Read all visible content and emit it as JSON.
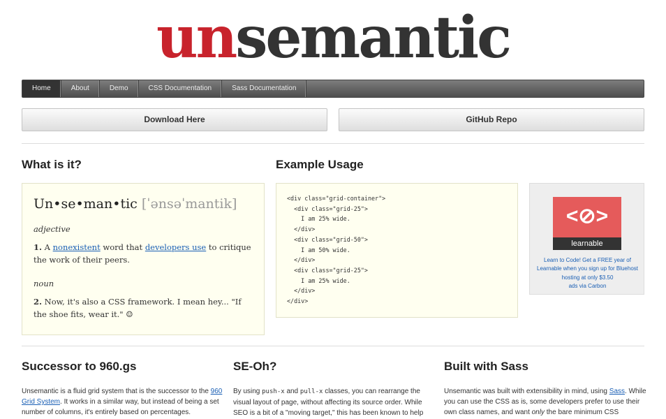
{
  "logo": {
    "part1": "un",
    "part2": "semantic"
  },
  "nav": {
    "items": [
      {
        "label": "Home",
        "active": true
      },
      {
        "label": "About"
      },
      {
        "label": "Demo"
      },
      {
        "label": "CSS Documentation"
      },
      {
        "label": "Sass Documentation"
      }
    ]
  },
  "buttons": {
    "download": "Download Here",
    "github": "GitHub Repo"
  },
  "what": {
    "heading": "What is it?",
    "word": "Un•se•man•tic",
    "pronunciation": "[ˈənsəˈmantik]",
    "pos1": "adjective",
    "def1_num": "1.",
    "def1_a": "A",
    "def1_link1": "nonexistent",
    "def1_b": "word that",
    "def1_link2": "developers use",
    "def1_c": "to critique the work of their peers.",
    "pos2": "noun",
    "def2_num": "2.",
    "def2_text": "Now, it's also a CSS framework. I mean hey... \"If the shoe fits, wear it.\" ☺"
  },
  "example": {
    "heading": "Example Usage",
    "code": "<div class=\"grid-container\">\n  <div class=\"grid-25\">\n    I am 25% wide.\n  </div>\n  <div class=\"grid-50\">\n    I am 50% wide.\n  </div>\n  <div class=\"grid-25\">\n    I am 25% wide.\n  </div>\n</div>"
  },
  "ad": {
    "brand": "learnable",
    "text": "Learn to Code! Get a FREE year of Learnable when you sign up for Bluehost hosting at only $3.50",
    "via": "ads via Carbon"
  },
  "columns": {
    "c1": {
      "heading": "Successor to 960.gs",
      "t1": "Unsemantic is a fluid grid system that is the successor to the",
      "link": "960 Grid System",
      "t2": ". It works in a similar way, but instead of being a set number of columns, it's entirely based on percentages."
    },
    "c2": {
      "heading": "SE-Oh?",
      "t1": "By using",
      "code1": "push-x",
      "t2": "and",
      "code2": "pull-x",
      "t3": "classes, you can rearrange the visual layout of page, without affecting its source order. While SEO is a bit of a \"moving target,\" this has been known to help"
    },
    "c3": {
      "heading": "Built with Sass",
      "t1": "Unsemantic was built with extensibility in mind, using",
      "link": "Sass",
      "t2": ". While you can use the CSS as is, some developers prefer to use their own class names, and want",
      "em": "only",
      "t3": "the bare minimum CSS"
    }
  }
}
